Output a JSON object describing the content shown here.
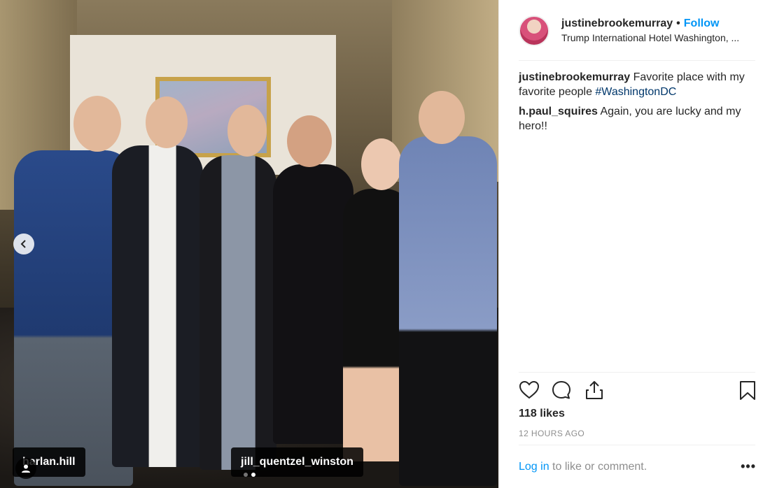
{
  "post": {
    "username": "justinebrookemurray",
    "separator": "•",
    "follow_label": "Follow",
    "location": "Trump International Hotel Washington, ...",
    "tags": [
      {
        "label": "harlan.hill"
      },
      {
        "label": "jill_quentzel_winston"
      }
    ],
    "comments": [
      {
        "user": "justinebrookemurray",
        "text": " Favorite place with my favorite people ",
        "hashtag": "#WashingtonDC"
      },
      {
        "user": "h.paul_squires",
        "text": " Again, you are lucky and my hero!!"
      }
    ],
    "likes": "118 likes",
    "time": "12 HOURS AGO",
    "login_link": "Log in",
    "login_text": " to like or comment.",
    "more": "•••"
  },
  "icons": {
    "prev": "chevron-left-icon",
    "heart": "heart-icon",
    "comment": "comment-icon",
    "share": "share-icon",
    "bookmark": "bookmark-icon",
    "user": "user-icon"
  },
  "colors": {
    "accent": "#0095f6",
    "hashtag": "#00376b",
    "muted": "#8e8e8e"
  },
  "carousel": {
    "slide_count": 2,
    "active_slide": 2
  }
}
